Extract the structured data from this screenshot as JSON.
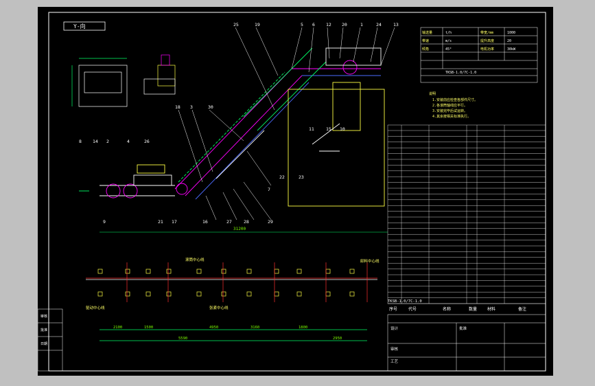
{
  "drawing": {
    "view_label": "Y-向",
    "stamp_caption": "TKSB-1.0/7C-1.0",
    "callouts_top": [
      "25",
      "19",
      "5",
      "6",
      "12",
      "20",
      "1",
      "24",
      "13"
    ],
    "callouts_mid": [
      "11",
      "15",
      "10",
      "23",
      "18",
      "3",
      "30",
      "7",
      "22"
    ],
    "callouts_left": [
      "8",
      "14",
      "2",
      "4",
      "26"
    ],
    "callouts_bottom": [
      "9",
      "21",
      "17",
      "16",
      "27",
      "28",
      "29"
    ],
    "dim_total": "31200",
    "dim_bottom_row": [
      "2100",
      "1500",
      "5590",
      "4950",
      "3160",
      "1800",
      "2950"
    ],
    "bottom_labels": [
      "驱动中心线",
      "滚筒中心线",
      "张紧中心线",
      "卸料中心线"
    ],
    "header_fields": [
      [
        "输送量",
        "t/h",
        "带宽/mm",
        "1000"
      ],
      [
        "带速",
        "m/s",
        "提升高度",
        "20"
      ],
      [
        "倾角",
        "45°",
        "电机功率",
        "30kW"
      ]
    ],
    "header_model": "TKSB-1.0/7C-1.0",
    "notes_title": "说明",
    "notes": [
      "1.安装前应检查各部件尺寸。",
      "2.各滚筒轴线应平行。",
      "3.安装完毕后试运转。",
      "4.其余按相关标准执行。"
    ],
    "table_header": [
      "序号",
      "代号",
      "名称",
      "数量",
      "材料",
      "备注"
    ],
    "title_block": [
      "设计",
      "审核",
      "工艺",
      "批准"
    ],
    "left_stamp": [
      "审核",
      "批准",
      "日期"
    ]
  },
  "colors": {
    "line": "#ffffff",
    "accent": "#ff00ff",
    "dim": "#00ff66",
    "yellow": "#ffff44",
    "cyan": "#00e5ff",
    "red": "#ff3030",
    "blue": "#4d6bff"
  }
}
